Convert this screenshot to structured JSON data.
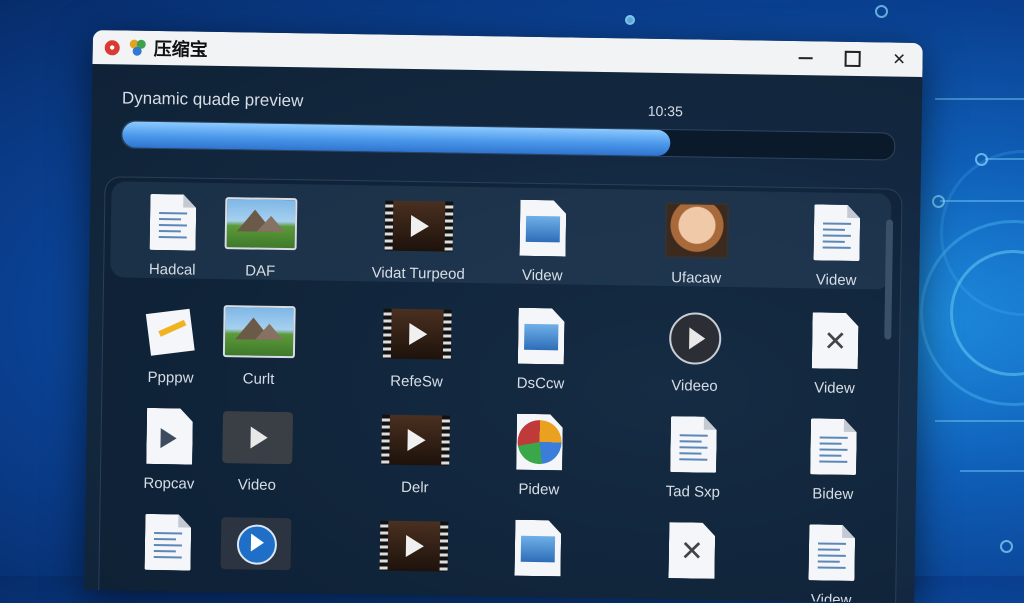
{
  "app": {
    "title": "压缩宝",
    "controls": {
      "minimize": "minimize",
      "maximize": "maximize",
      "close": "close"
    }
  },
  "preview": {
    "label": "Dynamic quade preview",
    "time": "10:35",
    "progress_percent": 71
  },
  "grid": {
    "rows": [
      [
        {
          "label": "Hadcal",
          "icon": "document-icon"
        },
        {
          "label": "DAF",
          "icon": "image-icon"
        },
        {
          "label": "Vidat Turpeod",
          "icon": "film-video-icon"
        },
        {
          "label": "Videw",
          "icon": "image-file-icon"
        },
        {
          "label": "Ufacaw",
          "icon": "photo-thumbnail-icon"
        },
        {
          "label": "Videw",
          "icon": "document-icon"
        }
      ],
      [
        {
          "label": "Ppppw",
          "icon": "envelope-icon"
        },
        {
          "label": "Curlt",
          "icon": "image-icon"
        },
        {
          "label": "RefeSw",
          "icon": "film-video-icon"
        },
        {
          "label": "DsCcw",
          "icon": "image-file-icon"
        },
        {
          "label": "Videeo",
          "icon": "circle-play-icon"
        },
        {
          "label": "Videw",
          "icon": "close-document-icon"
        }
      ],
      [
        {
          "label": "Ropcav",
          "icon": "arrow-document-icon"
        },
        {
          "label": "Video",
          "icon": "video-play-icon"
        },
        {
          "label": "Delr",
          "icon": "film-video-icon"
        },
        {
          "label": "Pidew",
          "icon": "pie-chart-document-icon"
        },
        {
          "label": "Tad Sxp",
          "icon": "document-icon"
        },
        {
          "label": "Bidew",
          "icon": "document-icon"
        }
      ],
      [
        {
          "label": "",
          "icon": "document-icon"
        },
        {
          "label": "",
          "icon": "blue-play-icon"
        },
        {
          "label": "",
          "icon": "film-video-icon"
        },
        {
          "label": "",
          "icon": "image-file-icon"
        },
        {
          "label": "",
          "icon": "close-document-icon"
        },
        {
          "label": "Videw",
          "icon": "document-icon"
        }
      ]
    ]
  }
}
